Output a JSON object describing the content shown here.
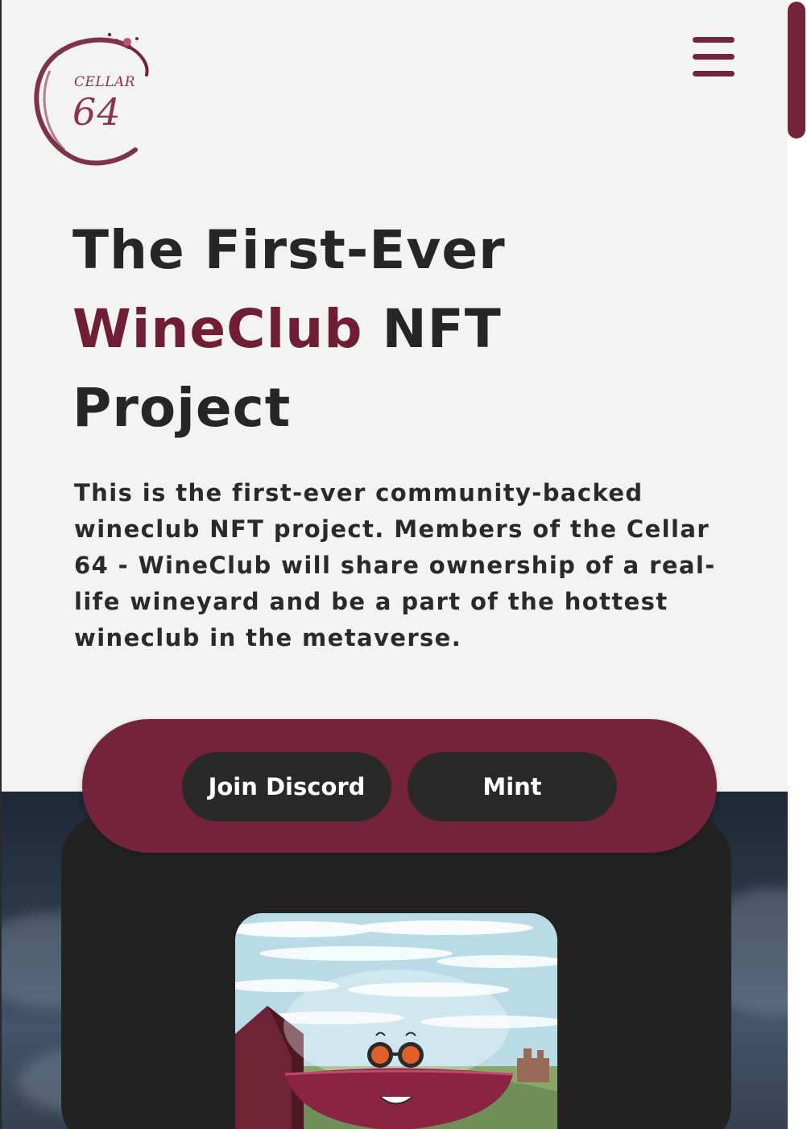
{
  "brand": {
    "logo_top": "CELLAR",
    "logo_num": "64"
  },
  "hero": {
    "title_line1": "The First-Ever",
    "title_accent": "WineClub",
    "title_line2_rest": " NFT",
    "title_line3": "Project",
    "description": "This is the first-ever community-backed wineclub NFT project. Members of the Cellar 64 - WineClub will share ownership of a real-life wineyard and be a part of the hottest wineclub in the metaverse."
  },
  "cta": {
    "discord_label": "Join Discord",
    "mint_label": "Mint"
  },
  "colors": {
    "accent": "#74233a",
    "text": "#262626",
    "background": "#f3f3f3",
    "button": "#292929"
  },
  "icons": {
    "menu": "hamburger-menu-icon",
    "logo": "wine-ring-logo"
  },
  "nft_preview": {
    "alt": "wine-glass-character-artwork"
  }
}
